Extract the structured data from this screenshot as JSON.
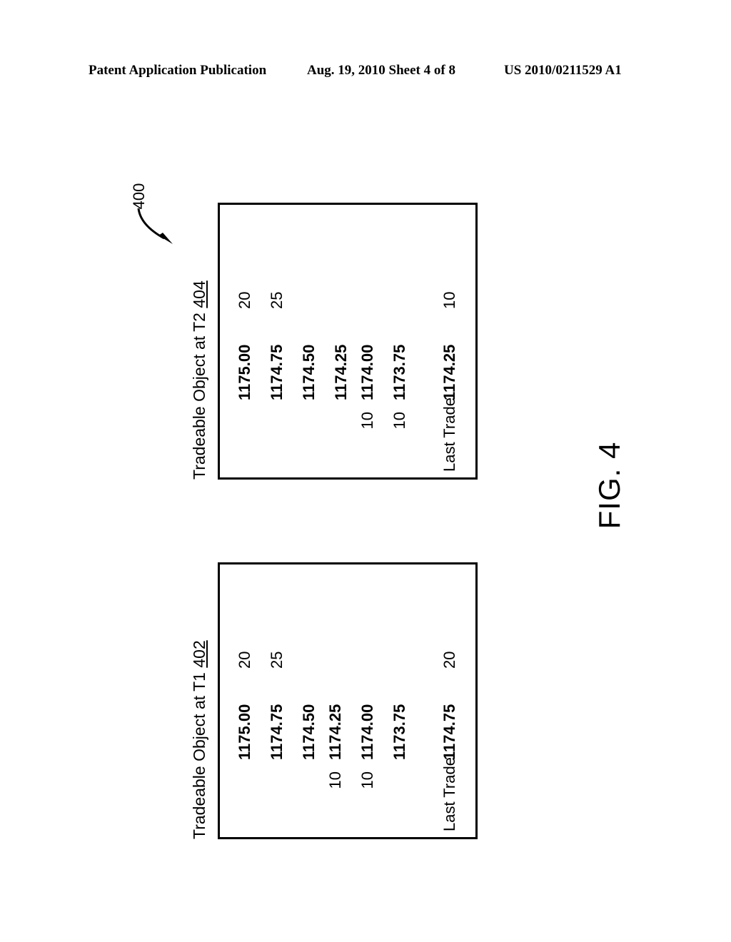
{
  "header": {
    "left": "Patent Application Publication",
    "center": "Aug. 19, 2010  Sheet 4 of 8",
    "right": "US 2010/0211529 A1"
  },
  "figure": {
    "caption": "FIG. 4",
    "reference_numeral": "400"
  },
  "books": [
    {
      "id": "t2",
      "title_text": "Tradeable Object at T2 ",
      "title_numeral": "404",
      "rows": [
        {
          "bid_qty": "",
          "price": "1175.00",
          "ask_qty": "20"
        },
        {
          "bid_qty": "",
          "price": "1174.75",
          "ask_qty": "25"
        },
        {
          "bid_qty": "",
          "price": "1174.50",
          "ask_qty": ""
        },
        {
          "bid_qty": "",
          "price": "1174.25",
          "ask_qty": ""
        },
        {
          "bid_qty": "10",
          "price": "1174.00",
          "ask_qty": ""
        },
        {
          "bid_qty": "10",
          "price": "1173.75",
          "ask_qty": ""
        }
      ],
      "last_trade": {
        "label": "Last Trade",
        "price": "1174.25",
        "qty": "10"
      }
    },
    {
      "id": "t1",
      "title_text": "Tradeable Object at T1 ",
      "title_numeral": "402",
      "rows": [
        {
          "bid_qty": "",
          "price": "1175.00",
          "ask_qty": "20"
        },
        {
          "bid_qty": "",
          "price": "1174.75",
          "ask_qty": "25"
        },
        {
          "bid_qty": "",
          "price": "1174.50",
          "ask_qty": ""
        },
        {
          "bid_qty": "10",
          "price": "1174.25",
          "ask_qty": ""
        },
        {
          "bid_qty": "10",
          "price": "1174.00",
          "ask_qty": ""
        },
        {
          "bid_qty": "",
          "price": "1173.75",
          "ask_qty": ""
        }
      ],
      "last_trade": {
        "label": "Last Trade",
        "price": "1174.75",
        "qty": "20"
      }
    }
  ],
  "colors": {
    "ink": "#000000",
    "paper": "#ffffff"
  }
}
